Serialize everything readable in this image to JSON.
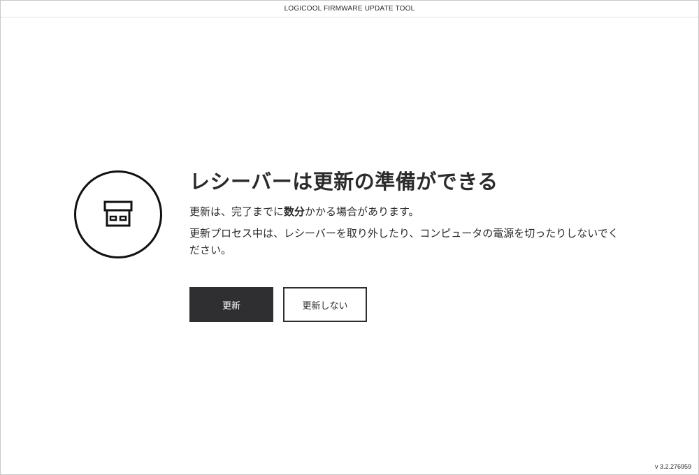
{
  "window": {
    "title": "LOGICOOL FIRMWARE UPDATE TOOL",
    "version": "v 3.2.276959"
  },
  "main": {
    "icon": "usb-receiver-icon",
    "heading": "レシーバーは更新の準備ができる",
    "desc_pre": "更新は、完了までに",
    "desc_bold": "数分",
    "desc_post": "かかる場合があります。",
    "warning": "更新プロセス中は、レシーバーを取り外したり、コンピュータの電源を切ったりしないでください。"
  },
  "buttons": {
    "update_label": "更新",
    "skip_label": "更新しない"
  },
  "colors": {
    "primary_button": "#2f2f31",
    "text": "#2b2b2b",
    "background": "#ffffff"
  }
}
